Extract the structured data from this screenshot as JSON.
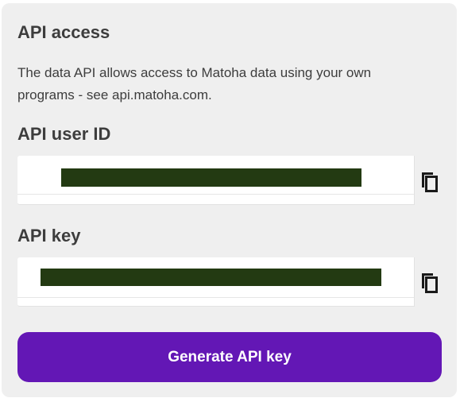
{
  "panel": {
    "title": "API access",
    "description": "The data API allows access to Matoha data using your own programs - see api.matoha.com."
  },
  "user_id": {
    "label": "API user ID",
    "value_redacted": true,
    "copy_icon": "copy-icon"
  },
  "api_key": {
    "label": "API key",
    "value_redacted": true,
    "copy_icon": "copy-icon"
  },
  "actions": {
    "generate_label": "Generate API key"
  },
  "colors": {
    "panel_bg": "#efefef",
    "button_bg": "#6317b5",
    "redaction": "#233a12"
  }
}
